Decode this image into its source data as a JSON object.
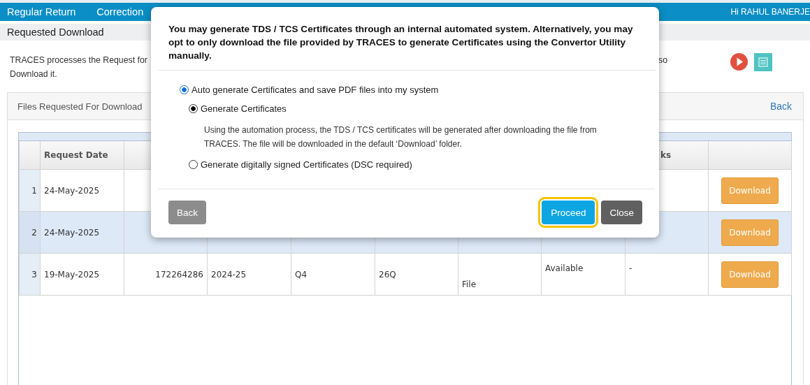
{
  "nav": {
    "items": [
      {
        "label": "Regular Return"
      },
      {
        "label": "Correction"
      }
    ],
    "greeting": "Hi RAHUL BANERJE"
  },
  "page_title": "Requested Download",
  "info": {
    "line_1_start": "TRACES processes the Request for",
    "line_1_end": "so",
    "line_2": "Download it."
  },
  "panel": {
    "title": "Files Requested For Download",
    "back_link": "Back"
  },
  "table": {
    "columns": [
      "Request Date",
      null,
      null,
      null,
      null,
      null,
      null,
      "ks",
      null
    ],
    "rows": [
      {
        "number": "1",
        "selected": false,
        "cells": [
          "24-May-2025",
          null,
          null,
          null,
          null,
          null,
          null,
          null
        ],
        "action": "Download"
      },
      {
        "number": "2",
        "selected": true,
        "cells": [
          "24-May-2025",
          null,
          null,
          null,
          null,
          null,
          null,
          null
        ],
        "action": "Download"
      },
      {
        "number": "3",
        "selected": false,
        "cells": [
          "19-May-2025",
          "172264286",
          "2024-25",
          "Q4",
          "26Q",
          "File",
          "Available",
          "-"
        ],
        "action": "Download"
      }
    ]
  },
  "modal": {
    "message": "You may generate TDS / TCS Certificates through an internal automated system. Alternatively, you may opt to only download the file provided by TRACES to generate Certificates using the Convertor Utility manually.",
    "options": [
      {
        "label": "Auto generate Certificates and save PDF files into my system",
        "selected": true,
        "children": [
          {
            "label": "Generate Certificates",
            "selected": true,
            "description": "Using the automation process, the TDS / TCS certificates will be generated after downloading the file from TRACES. The file will be downloaded in the default ‘Download’ folder."
          },
          {
            "label": "Generate digitally signed Certificates (DSC required)",
            "selected": false
          }
        ]
      }
    ],
    "buttons": [
      {
        "label": "Back",
        "kind": "secondary",
        "focused": false
      },
      {
        "label": "Proceed",
        "kind": "primary",
        "focused": true
      },
      {
        "label": "Close",
        "kind": "dark",
        "focused": false
      }
    ]
  }
}
